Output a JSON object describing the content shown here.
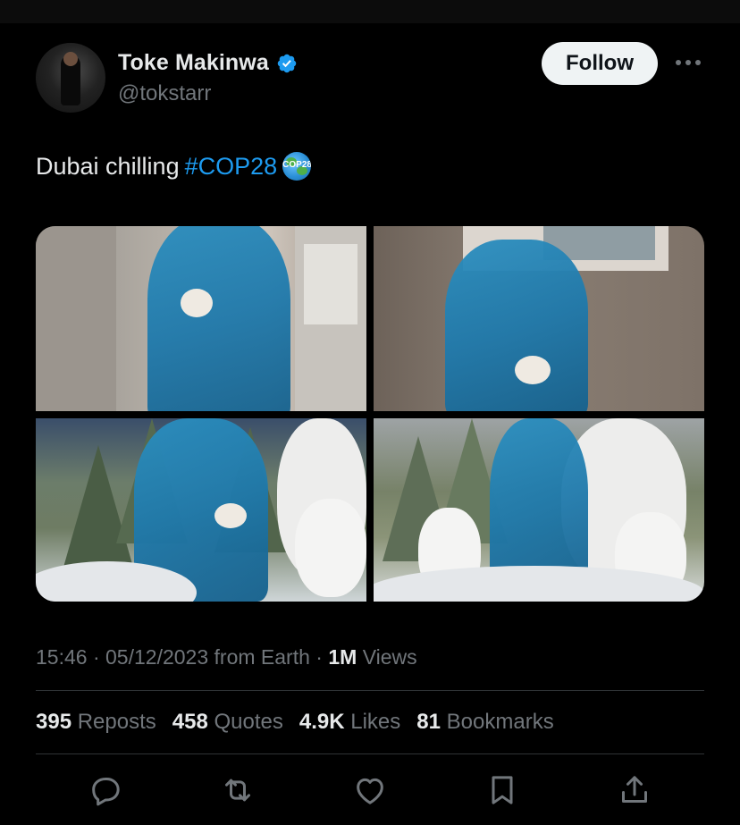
{
  "tweet": {
    "author": {
      "name": "Toke Makinwa",
      "handle": "@tokstarr",
      "verified_icon": "verified-badge-icon"
    },
    "follow_label": "Follow",
    "more_icon": "more-options-icon",
    "text": "Dubai chilling ",
    "hashtag": "#COP28",
    "emoji_label": "COP28",
    "media": [
      {
        "icon": "photo"
      },
      {
        "icon": "photo"
      },
      {
        "icon": "photo"
      },
      {
        "icon": "photo"
      }
    ],
    "meta": {
      "time": "15:46",
      "sep1": " · ",
      "date": "05/12/2023",
      "from": " from Earth",
      "sep2": " · ",
      "views_count": "1M",
      "views_label": " Views"
    },
    "stats": {
      "reposts": {
        "count": "395",
        "label": "Reposts"
      },
      "quotes": {
        "count": "458",
        "label": "Quotes"
      },
      "likes": {
        "count": "4.9K",
        "label": "Likes"
      },
      "bookmarks": {
        "count": "81",
        "label": "Bookmarks"
      }
    },
    "actions": [
      "reply-icon",
      "repost-icon",
      "like-icon",
      "bookmark-icon",
      "share-icon"
    ]
  },
  "colors": {
    "background": "#000000",
    "text": "#e7e9ea",
    "secondary": "#71767b",
    "accent": "#1d9bf0",
    "divider": "#2f3336"
  }
}
